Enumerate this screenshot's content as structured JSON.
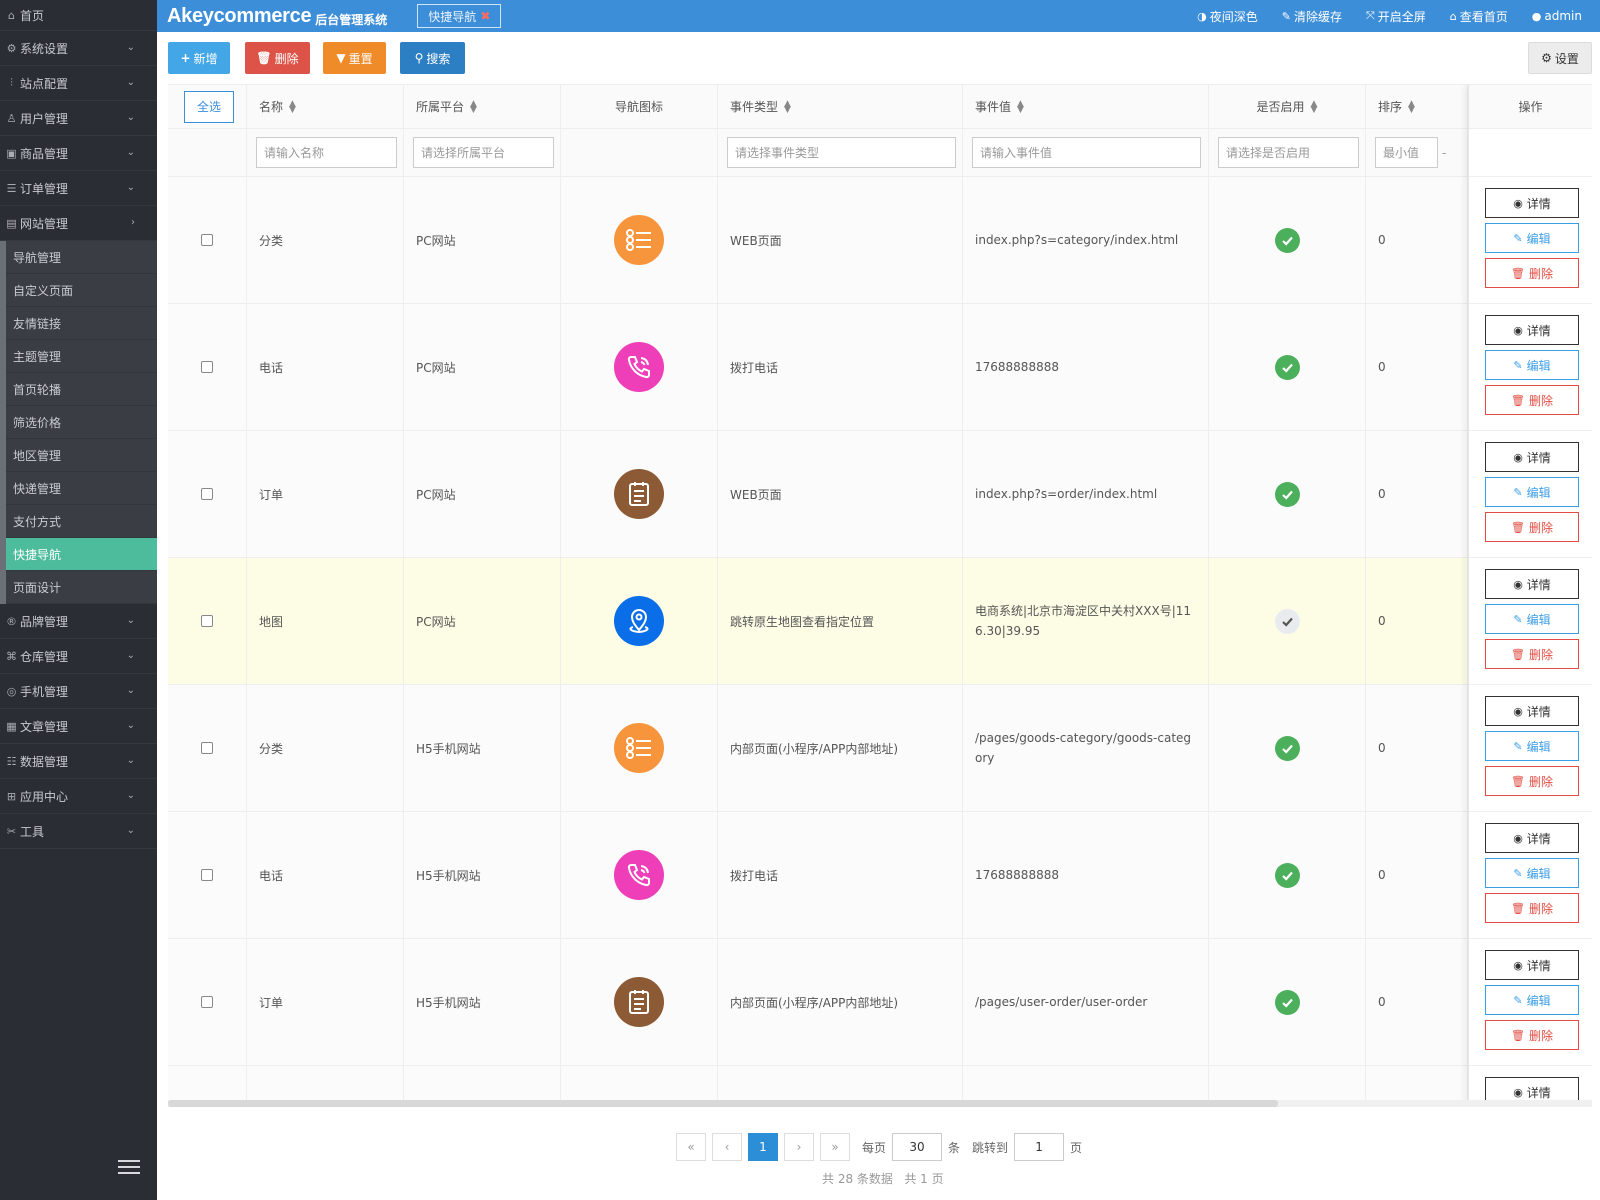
{
  "sidebar": {
    "home": {
      "label": "首页",
      "icon": "home-icon"
    },
    "menus": [
      {
        "label": "系统设置",
        "icon": "gear-icon",
        "chevron": "⌄"
      },
      {
        "label": "站点配置",
        "icon": "sliders-icon",
        "chevron": "⌄"
      },
      {
        "label": "用户管理",
        "icon": "user-icon",
        "chevron": "⌄"
      },
      {
        "label": "商品管理",
        "icon": "shopping-bag-icon",
        "chevron": "⌄"
      },
      {
        "label": "订单管理",
        "icon": "list-icon",
        "chevron": "⌄"
      },
      {
        "label": "网站管理",
        "icon": "website-icon",
        "chevron": "›"
      }
    ],
    "submenu": [
      "导航管理",
      "自定义页面",
      "友情链接",
      "主题管理",
      "首页轮播",
      "筛选价格",
      "地区管理",
      "快递管理",
      "支付方式",
      "快捷导航",
      "页面设计"
    ],
    "active_sub": "快捷导航",
    "menus_after": [
      {
        "label": "品牌管理",
        "icon": "brand-icon",
        "chevron": "⌄"
      },
      {
        "label": "仓库管理",
        "icon": "warehouse-icon",
        "chevron": "⌄"
      },
      {
        "label": "手机管理",
        "icon": "mobile-icon",
        "chevron": "⌄"
      },
      {
        "label": "文章管理",
        "icon": "article-icon",
        "chevron": "⌄"
      },
      {
        "label": "数据管理",
        "icon": "database-icon",
        "chevron": "⌄"
      },
      {
        "label": "应用中心",
        "icon": "apps-icon",
        "chevron": "⌄"
      },
      {
        "label": "工具",
        "icon": "tools-icon",
        "chevron": "⌄"
      }
    ]
  },
  "header": {
    "brand": "Akeycommerce",
    "brand_sub": "后台管理系统",
    "tab": "快捷导航",
    "links": [
      {
        "label": "夜间深色",
        "icon": "contrast-icon",
        "glyph": "◑"
      },
      {
        "label": "清除缓存",
        "icon": "brush-icon",
        "glyph": "✎"
      },
      {
        "label": "开启全屏",
        "icon": "fullscreen-icon",
        "glyph": "⤧"
      },
      {
        "label": "查看首页",
        "icon": "home-icon",
        "glyph": "⌂"
      },
      {
        "label": "admin",
        "icon": "user-icon",
        "glyph": "●"
      }
    ]
  },
  "toolbar": {
    "add": "新增",
    "delete": "删除",
    "reset": "重置",
    "search": "搜索",
    "settings": "设置"
  },
  "table": {
    "select_all": "全选",
    "headers": {
      "name": "名称",
      "platform": "所属平台",
      "icon": "导航图标",
      "event_type": "事件类型",
      "event_value": "事件值",
      "enabled": "是否启用",
      "sort": "排序",
      "ops": "操作"
    },
    "placeholders": {
      "name": "请输入名称",
      "platform": "请选择所属平台",
      "event_type": "请选择事件类型",
      "event_value": "请输入事件值",
      "enabled": "请选择是否启用",
      "sort_min": "最小值"
    },
    "rows": [
      {
        "name": "分类",
        "platform": "PC网站",
        "icon": "category-list-icon",
        "icon_color": "#f7953d",
        "event_type": "WEB页面",
        "event_value": "index.php?s=category/index.html",
        "enabled": true,
        "sort": "0",
        "highlight": false
      },
      {
        "name": "电话",
        "platform": "PC网站",
        "icon": "phone-icon",
        "icon_color": "#ee3fb9",
        "event_type": "拨打电话",
        "event_value": "17688888888",
        "enabled": true,
        "sort": "0",
        "highlight": false
      },
      {
        "name": "订单",
        "platform": "PC网站",
        "icon": "order-icon",
        "icon_color": "#8d5a36",
        "event_type": "WEB页面",
        "event_value": "index.php?s=order/index.html",
        "enabled": true,
        "sort": "0",
        "highlight": false
      },
      {
        "name": "地图",
        "platform": "PC网站",
        "icon": "map-pin-icon",
        "icon_color": "#0a6ee8",
        "event_type": "跳转原生地图查看指定位置",
        "event_value": "电商系统|北京市海淀区中关村XXX号|116.30|39.95",
        "enabled": false,
        "sort": "0",
        "highlight": true
      },
      {
        "name": "分类",
        "platform": "H5手机网站",
        "icon": "category-list-icon",
        "icon_color": "#f7953d",
        "event_type": "内部页面(小程序/APP内部地址)",
        "event_value": "/pages/goods-category/goods-category",
        "enabled": true,
        "sort": "0",
        "highlight": false
      },
      {
        "name": "电话",
        "platform": "H5手机网站",
        "icon": "phone-icon",
        "icon_color": "#ee3fb9",
        "event_type": "拨打电话",
        "event_value": "17688888888",
        "enabled": true,
        "sort": "0",
        "highlight": false
      },
      {
        "name": "订单",
        "platform": "H5手机网站",
        "icon": "order-icon",
        "icon_color": "#8d5a36",
        "event_type": "内部页面(小程序/APP内部地址)",
        "event_value": "/pages/user-order/user-order",
        "enabled": true,
        "sort": "0",
        "highlight": false
      }
    ],
    "ops": {
      "detail": "详情",
      "edit": "编辑",
      "delete": "删除"
    }
  },
  "pagination": {
    "first": "«",
    "prev": "‹",
    "current": "1",
    "next": "›",
    "last": "»",
    "per_page_label": "每页",
    "per_page": "30",
    "per_page_unit": "条",
    "jump_label": "跳转到",
    "jump_value": "1",
    "jump_unit": "页",
    "summary": "共 28 条数据   共 1 页"
  }
}
